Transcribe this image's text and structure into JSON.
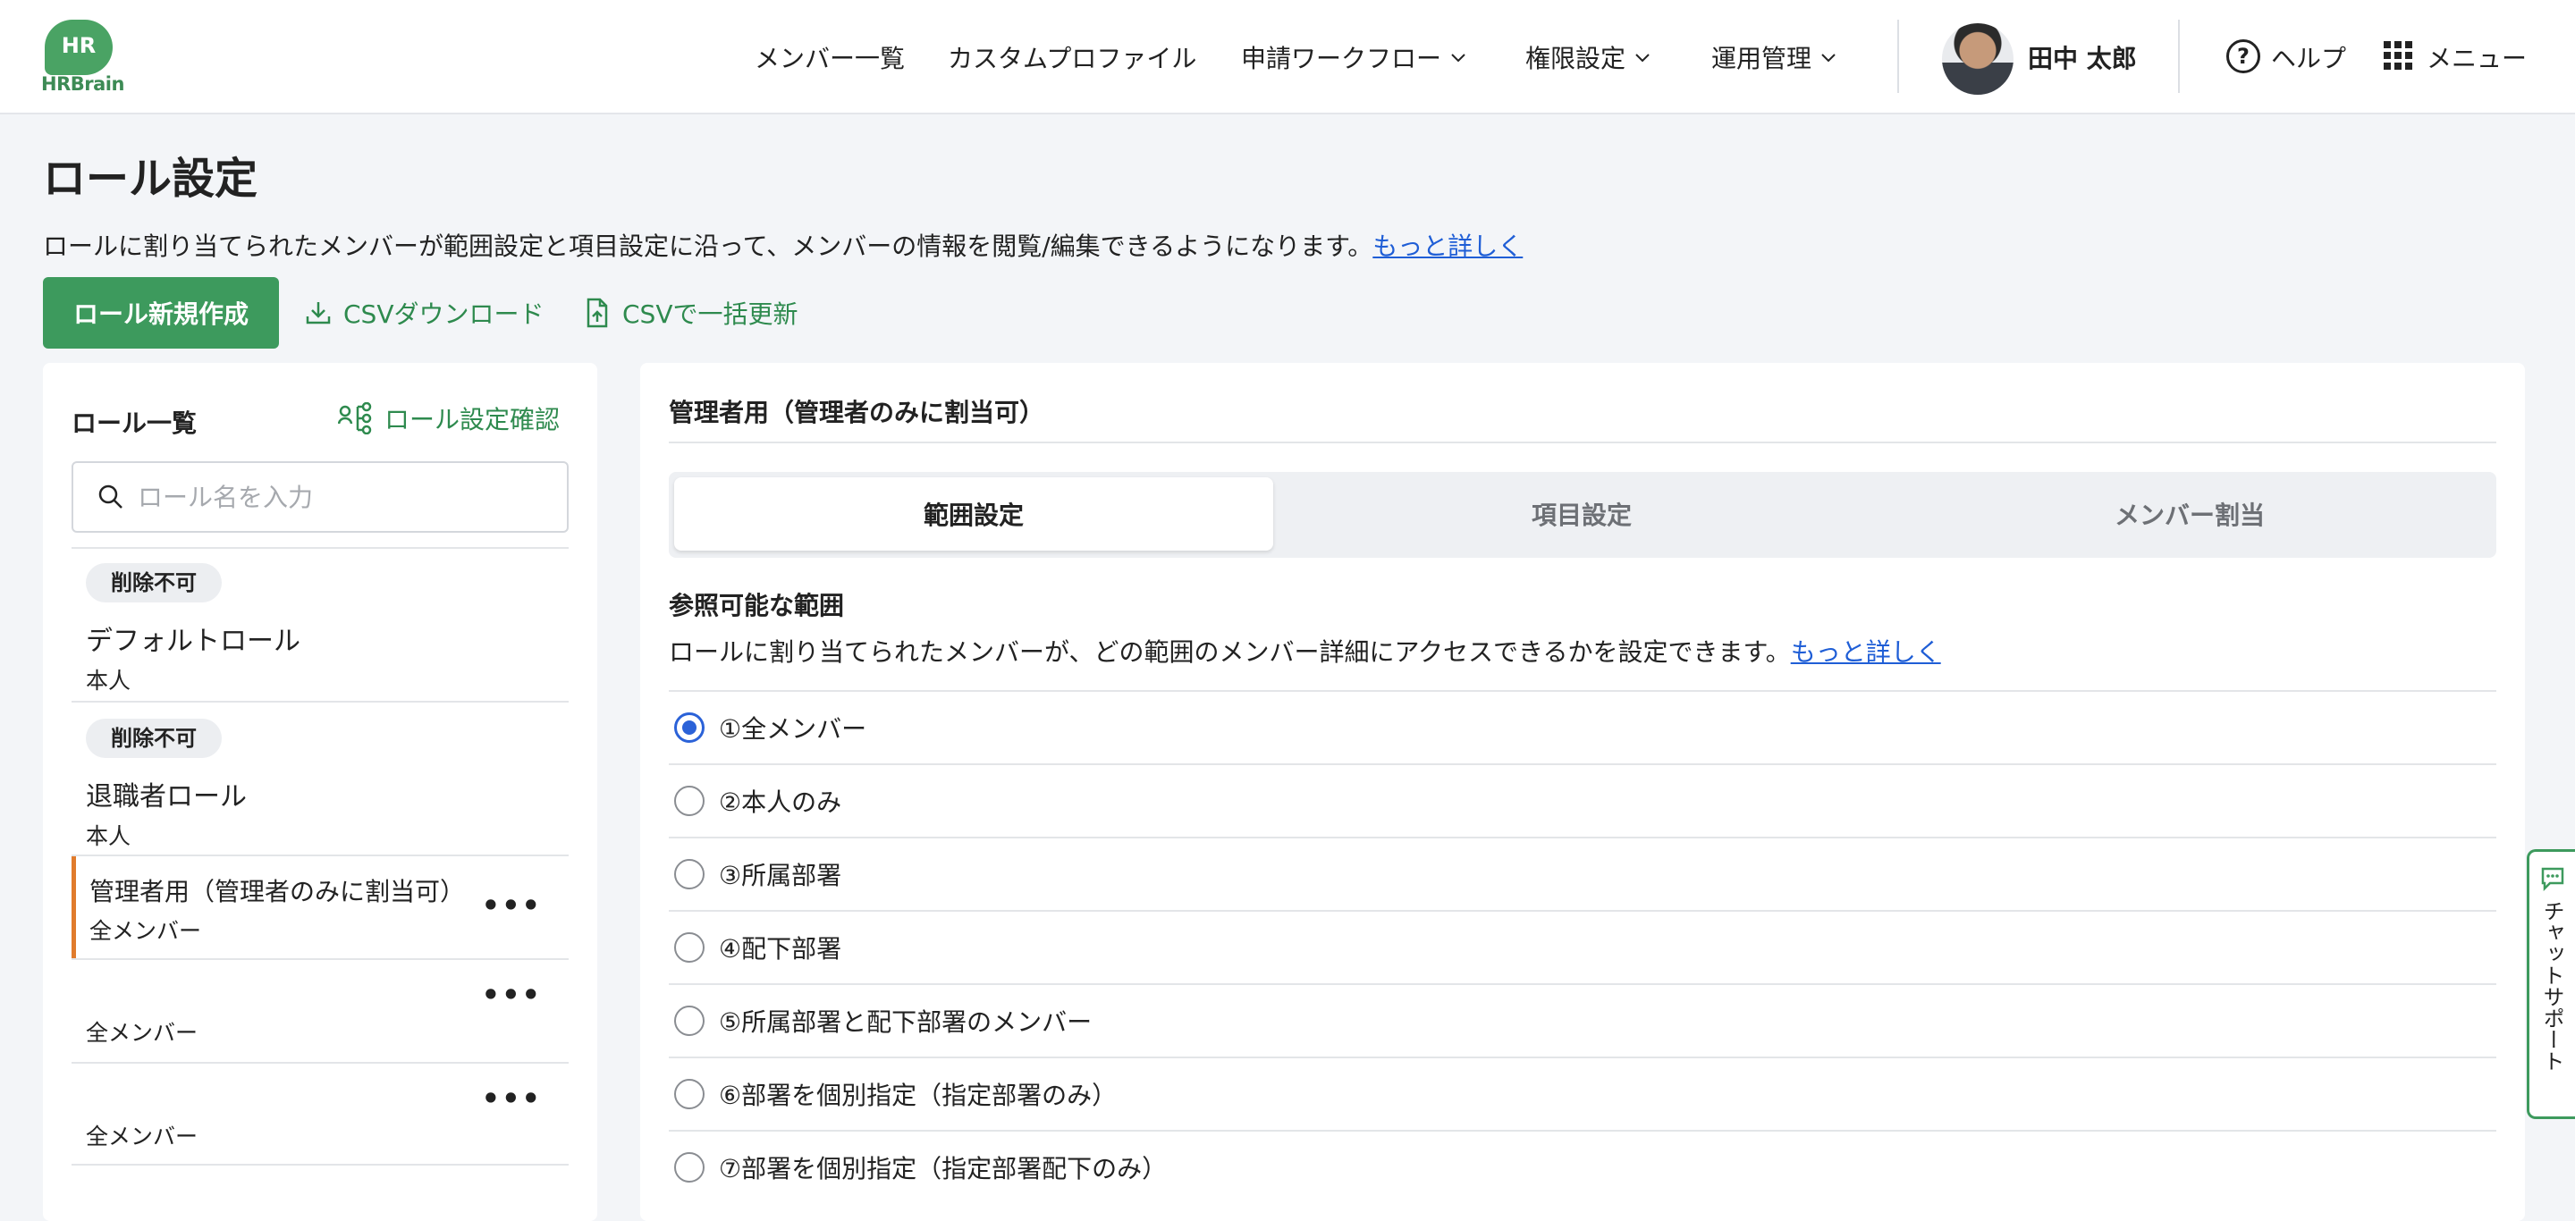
{
  "header": {
    "logo_text": "HR",
    "logo_word": "HRBrain",
    "nav": [
      "メンバー一覧",
      "カスタムプロファイル",
      "申請ワークフロー",
      "権限設定",
      "運用管理"
    ],
    "user_name": "田中 太郎",
    "help": "ヘルプ",
    "menu": "メニュー"
  },
  "page": {
    "title": "ロール設定",
    "description": "ロールに割り当てられたメンバーが範囲設定と項目設定に沿って、メンバーの情報を閲覧/編集できるようになります。",
    "more_link": "もっと詳しく",
    "new_role_button": "ロール新規作成",
    "csv_download": "CSVダウンロード",
    "csv_bulk_update": "CSVで一括更新"
  },
  "role_list": {
    "title": "ロール一覧",
    "check_link": "ロール設定確認",
    "search_placeholder": "ロール名を入力",
    "items": [
      {
        "badge": "削除不可",
        "name": "デフォルトロール",
        "scope": "本人"
      },
      {
        "badge": "削除不可",
        "name": "退職者ロール",
        "scope": "本人"
      },
      {
        "badge": "",
        "name": "管理者用（管理者のみに割当可）",
        "scope": "全メンバー",
        "more": "•••"
      },
      {
        "badge": "",
        "name": "",
        "scope": "全メンバー",
        "more": "•••"
      },
      {
        "badge": "",
        "name": "",
        "scope": "全メンバー",
        "more": "•••"
      }
    ]
  },
  "detail": {
    "title": "管理者用（管理者のみに割当可）",
    "tabs": [
      "範囲設定",
      "項目設定",
      "メンバー割当"
    ],
    "active_tab": "範囲設定",
    "section_title": "参照可能な範囲",
    "section_desc": "ロールに割り当てられたメンバーが、どの範囲のメンバー詳細にアクセスできるかを設定できます。",
    "section_link": "もっと詳しく",
    "options": [
      "①全メンバー",
      "②本人のみ",
      "③所属部署",
      "④配下部署",
      "⑤所属部署と配下部署のメンバー",
      "⑥部署を個別指定（指定部署のみ）",
      "⑦部署を個別指定（指定部署配下のみ）"
    ],
    "selected_option": "①全メンバー"
  },
  "chat_support": "チャットサポート",
  "colors": {
    "brand_green": "#3d9a5d",
    "link_blue": "#1f5ed6",
    "radio_blue": "#2b62d8",
    "selected_accent": "#e07b2c"
  }
}
